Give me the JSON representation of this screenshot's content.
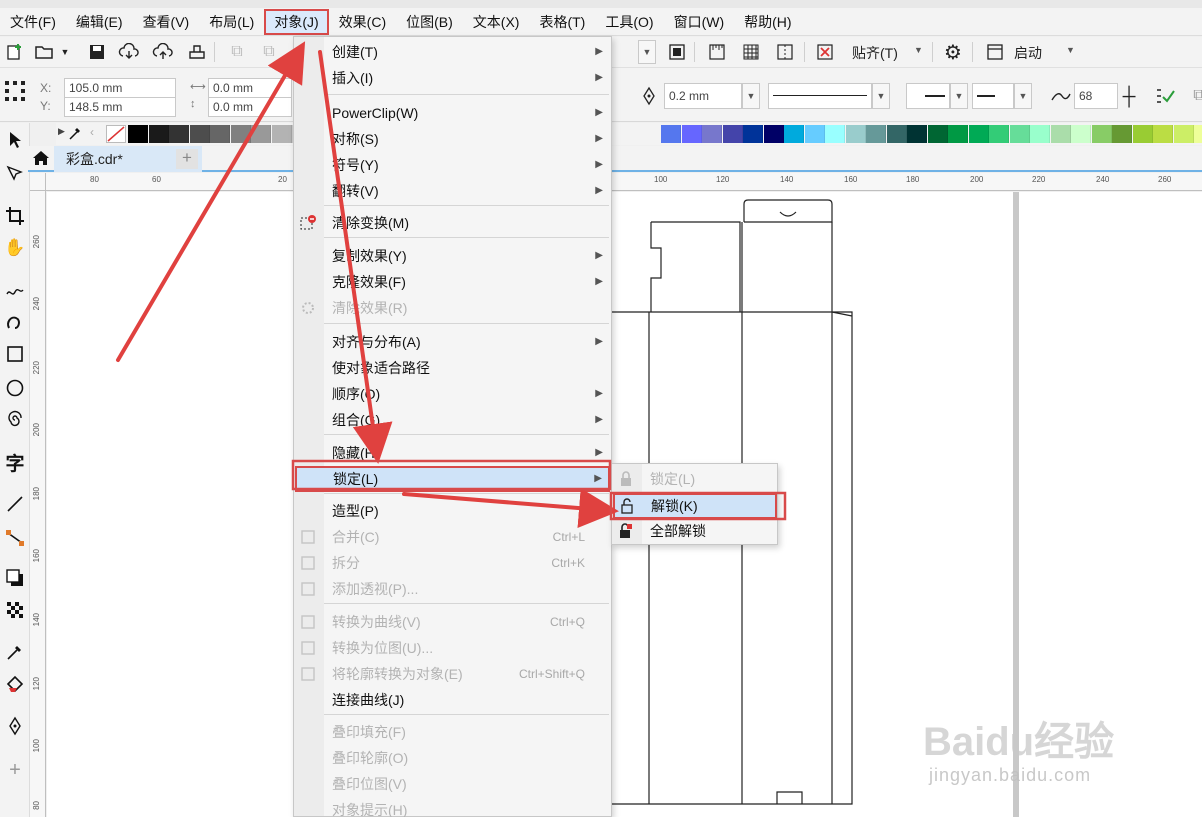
{
  "menubar": {
    "items": [
      {
        "label": "文件(F)"
      },
      {
        "label": "编辑(E)"
      },
      {
        "label": "查看(V)"
      },
      {
        "label": "布局(L)"
      },
      {
        "label": "对象(J)"
      },
      {
        "label": "效果(C)"
      },
      {
        "label": "位图(B)"
      },
      {
        "label": "文本(X)"
      },
      {
        "label": "表格(T)"
      },
      {
        "label": "工具(O)"
      },
      {
        "label": "窗口(W)"
      },
      {
        "label": "帮助(H)"
      }
    ]
  },
  "toolbar1": {
    "snap_label": "贴齐(T)",
    "launch_label": "启动"
  },
  "toolbar2": {
    "x_label": "X:",
    "y_label": "Y:",
    "x_value": "105.0 mm",
    "y_value": "148.5 mm",
    "w_value": "0.0 mm",
    "h_value": "0.0 mm",
    "outline_width": "0.2 mm",
    "smooth_value": "68"
  },
  "document": {
    "tab_label": "彩盒.cdr*"
  },
  "hruler": {
    "ticks": [
      "80",
      "60",
      "20",
      "100",
      "120",
      "140",
      "160",
      "180",
      "200",
      "220",
      "240",
      "260"
    ]
  },
  "vruler": {
    "ticks": [
      "260",
      "240",
      "220",
      "200",
      "180",
      "160",
      "140",
      "120",
      "100",
      "80"
    ]
  },
  "object_menu": {
    "items": [
      {
        "label": "创建(T)"
      },
      {
        "label": "插入(I)"
      },
      {
        "label": "PowerClip(W)"
      },
      {
        "label": "对称(S)"
      },
      {
        "label": "符号(Y)"
      },
      {
        "label": "翻转(V)"
      },
      {
        "label": "清除变换(M)"
      },
      {
        "label": "复制效果(Y)"
      },
      {
        "label": "克隆效果(F)"
      },
      {
        "label": "清除效果(R)"
      },
      {
        "label": "对齐与分布(A)"
      },
      {
        "label": "使对象适合路径"
      },
      {
        "label": "顺序(O)"
      },
      {
        "label": "组合(G)"
      },
      {
        "label": "隐藏(H)"
      },
      {
        "label": "锁定(L)"
      },
      {
        "label": "造型(P)"
      },
      {
        "label": "合并(C)",
        "shortcut": "Ctrl+L"
      },
      {
        "label": "拆分",
        "shortcut": "Ctrl+K"
      },
      {
        "label": "添加透视(P)..."
      },
      {
        "label": "转换为曲线(V)",
        "shortcut": "Ctrl+Q"
      },
      {
        "label": "转换为位图(U)..."
      },
      {
        "label": "将轮廓转换为对象(E)",
        "shortcut": "Ctrl+Shift+Q"
      },
      {
        "label": "连接曲线(J)"
      },
      {
        "label": "叠印填充(F)"
      },
      {
        "label": "叠印轮廓(O)"
      },
      {
        "label": "叠印位图(V)"
      },
      {
        "label": "对象提示(H)"
      }
    ]
  },
  "lock_submenu": {
    "items": [
      {
        "label": "锁定(L)"
      },
      {
        "label": "解锁(K)"
      },
      {
        "label": "全部解锁"
      }
    ]
  },
  "watermark": {
    "brand": "Baidu经验",
    "url": "jingyan.baidu.com"
  },
  "colors": {
    "accent_red": "#e0413f",
    "highlight_blue": "#cfe3f8",
    "tab_blue": "#6fb2e6"
  }
}
